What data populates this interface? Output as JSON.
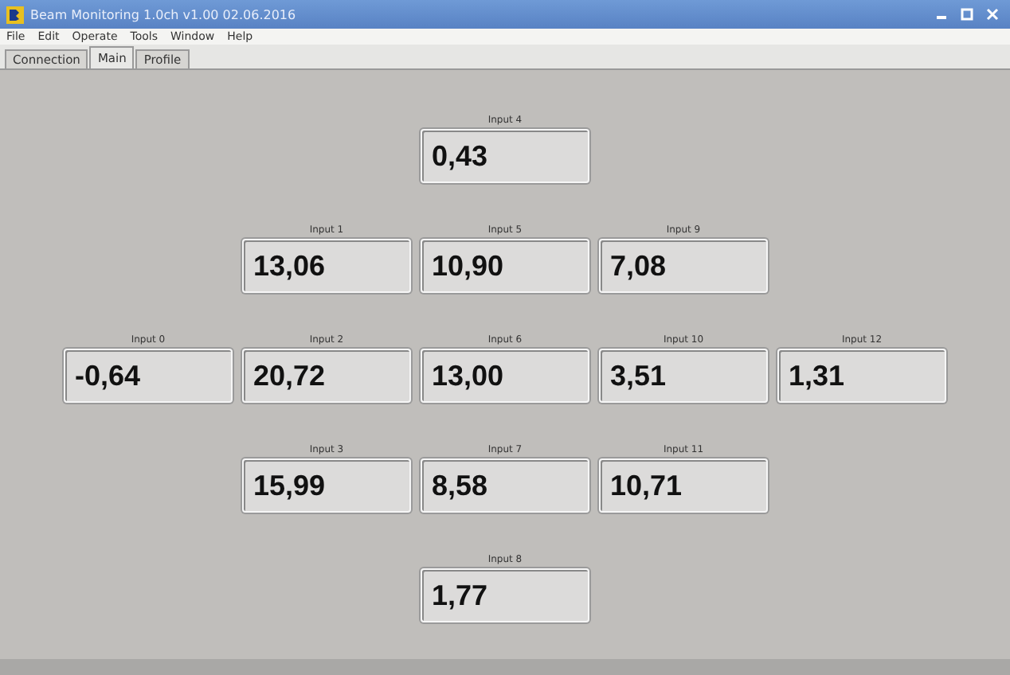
{
  "window": {
    "title": "Beam Monitoring 1.0ch  v1.00 02.06.2016"
  },
  "menu": [
    "File",
    "Edit",
    "Operate",
    "Tools",
    "Window",
    "Help"
  ],
  "tabs": [
    {
      "label": "Connection",
      "selected": false
    },
    {
      "label": "Main",
      "selected": true
    },
    {
      "label": "Profile",
      "selected": false
    }
  ],
  "rows": [
    [
      {
        "label": "Input 4",
        "value": "0,43"
      }
    ],
    [
      {
        "label": "Input 1",
        "value": "13,06"
      },
      {
        "label": "Input 5",
        "value": "10,90"
      },
      {
        "label": "Input 9",
        "value": "7,08"
      }
    ],
    [
      {
        "label": "Input 0",
        "value": "-0,64"
      },
      {
        "label": "Input 2",
        "value": "20,72"
      },
      {
        "label": "Input 6",
        "value": "13,00"
      },
      {
        "label": "Input 10",
        "value": "3,51"
      },
      {
        "label": "Input 12",
        "value": "1,31"
      }
    ],
    [
      {
        "label": "Input 3",
        "value": "15,99"
      },
      {
        "label": "Input 7",
        "value": "8,58"
      },
      {
        "label": "Input 11",
        "value": "10,71"
      }
    ],
    [
      {
        "label": "Input 8",
        "value": "1,77"
      }
    ]
  ]
}
